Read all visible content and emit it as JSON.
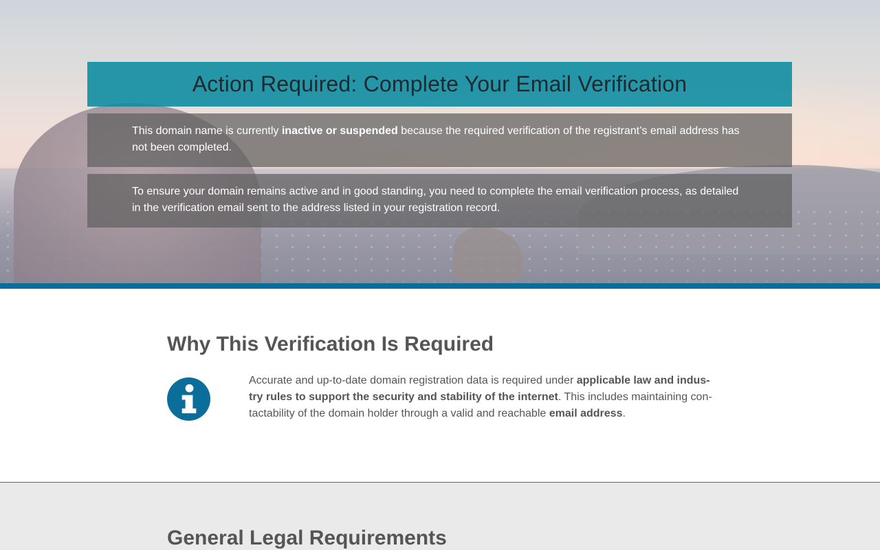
{
  "hero": {
    "title": "Action Required: Complete Your Email Verification",
    "notice1": {
      "before": "This domain name is currently ",
      "bold": "inactive or suspended",
      "after": " because the required verification of the registrant’s email address has not been completed."
    },
    "notice2": "To ensure your domain remains active and in good standing, you need to complete the email verification process, as detailed in the verification email sent to the address listed in your registration record."
  },
  "why": {
    "heading": "Why This Verification Is Required",
    "icon": "info-icon",
    "text": {
      "part1": "Accurate and up-to-date domain registration data is required under ",
      "bold1": "applicable law and indus-try rules to support the security and stability of the internet",
      "part2": ". This includes maintaining con-tactability of the domain holder through a valid and reachable ",
      "bold2": "email address",
      "part3": "."
    }
  },
  "legal": {
    "heading": "General Legal Requirements"
  },
  "colors": {
    "banner": "#0a8ca0",
    "accent_rule": "#0b6e9a",
    "icon": "#0b6e9a",
    "divider": "#1f8a6a",
    "legal_bg": "#eaeaea"
  }
}
